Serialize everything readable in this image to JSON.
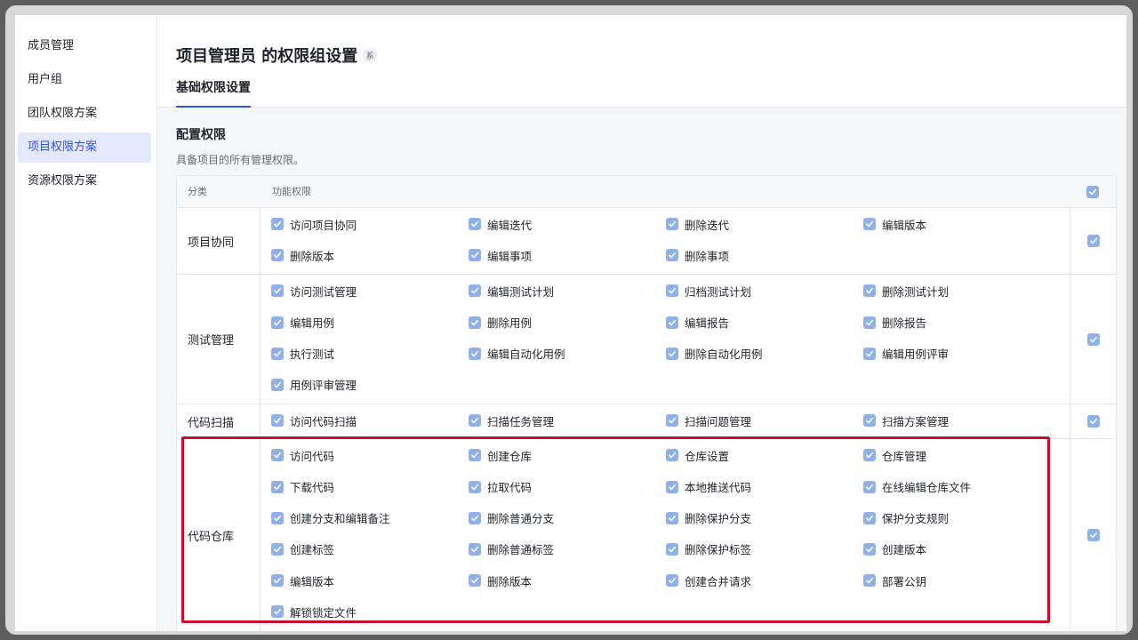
{
  "sidebar": {
    "items": [
      {
        "label": "成员管理"
      },
      {
        "label": "用户组"
      },
      {
        "label": "团队权限方案"
      },
      {
        "label": "项目权限方案",
        "active": true
      },
      {
        "label": "资源权限方案"
      }
    ]
  },
  "header": {
    "title": "项目管理员 的权限组设置",
    "badge": "系"
  },
  "tabs": [
    {
      "label": "基础权限设置",
      "active": true
    }
  ],
  "section": {
    "title": "配置权限",
    "description": "具备项目的所有管理权限。"
  },
  "table": {
    "col_category": "分类",
    "col_permissions": "功能权限",
    "select_all_checked": true,
    "rows": [
      {
        "category": "项目协同",
        "checked": true,
        "perms": [
          "访问项目协同",
          "编辑迭代",
          "删除迭代",
          "编辑版本",
          "删除版本",
          "编辑事项",
          "删除事项"
        ]
      },
      {
        "category": "测试管理",
        "checked": true,
        "perms": [
          "访问测试管理",
          "编辑测试计划",
          "归档测试计划",
          "删除测试计划",
          "编辑用例",
          "删除用例",
          "编辑报告",
          "删除报告",
          "执行测试",
          "编辑自动化用例",
          "删除自动化用例",
          "编辑用例评审",
          "用例评审管理"
        ]
      },
      {
        "category": "代码扫描",
        "checked": true,
        "perms": [
          "访问代码扫描",
          "扫描任务管理",
          "扫描问题管理",
          "扫描方案管理"
        ]
      },
      {
        "category": "代码仓库",
        "checked": true,
        "perms": [
          "访问代码",
          "创建仓库",
          "仓库设置",
          "仓库管理",
          "下载代码",
          "拉取代码",
          "本地推送代码",
          "在线编辑仓库文件",
          "创建分支和编辑备注",
          "删除普通分支",
          "删除保护分支",
          "保护分支规则",
          "创建标签",
          "删除普通标签",
          "删除保护标签",
          "创建版本",
          "编辑版本",
          "删除版本",
          "创建合并请求",
          "部署公钥",
          "解锁锁定文件"
        ]
      }
    ]
  },
  "colors": {
    "accent": "#2f54eb",
    "checkbox": "#8fb0e8",
    "highlight": "#c8102e"
  }
}
